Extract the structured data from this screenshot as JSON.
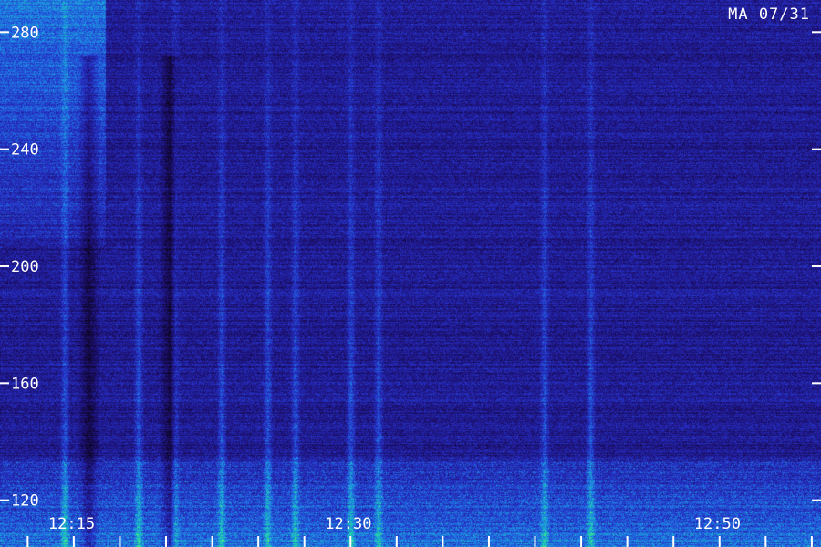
{
  "station_label": "MA 07/31",
  "chart_data": {
    "type": "heatmap",
    "title": "",
    "xlabel": "",
    "ylabel": "",
    "y_ticks": [
      "280",
      "240",
      "200",
      "160",
      "120"
    ],
    "y_tick_values": [
      280,
      240,
      200,
      160,
      120
    ],
    "x_ticks": [
      "12:15",
      "12:30",
      "12:50"
    ],
    "x_tick_values_minutes": [
      735,
      750,
      770
    ],
    "xlim_minutes": [
      731,
      775.5
    ],
    "ylim": [
      104,
      291
    ],
    "minor_x_tick_step_minutes": 2.5,
    "colormap": [
      "#0a0418",
      "#1c0f6e",
      "#2630c8",
      "#1d8ae8",
      "#20e0a0",
      "#b0ff40"
    ],
    "bright_columns_time": [
      734.5,
      738.5,
      740.5,
      743,
      745.5,
      747,
      750,
      751.5,
      760.5,
      763
    ],
    "dark_columns_time": [
      735.8,
      740.2
    ],
    "upper_left_glow_until": 736.7,
    "lower_band_ceiling": 135
  }
}
